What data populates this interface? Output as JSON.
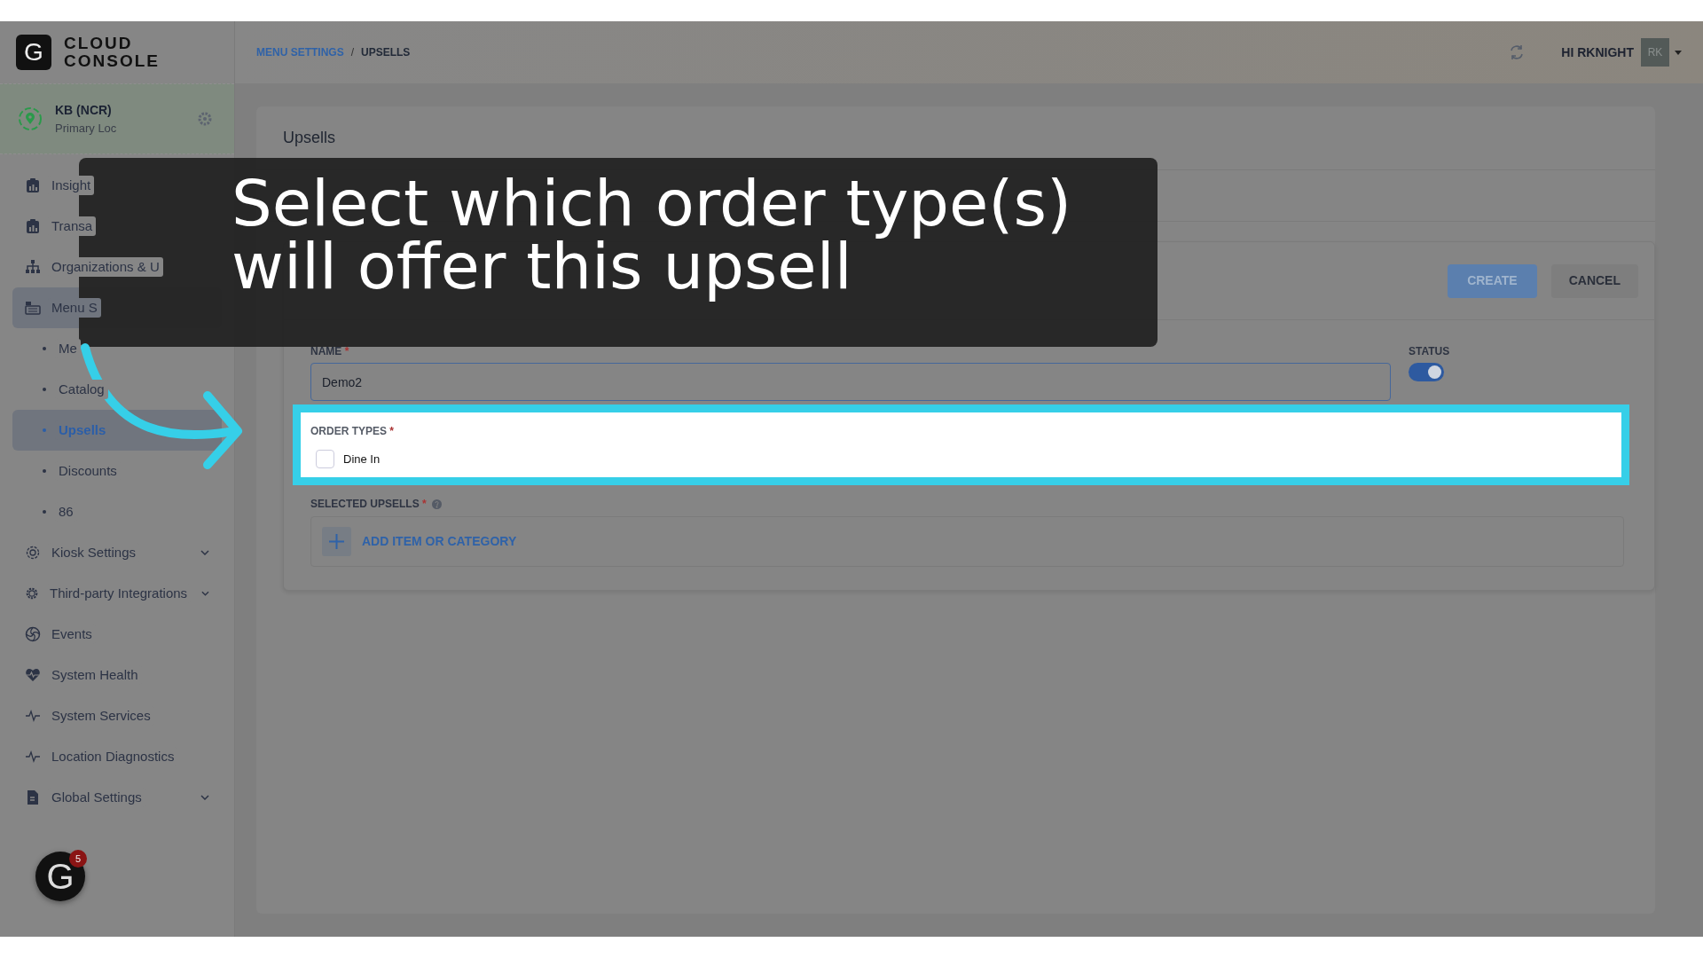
{
  "app": {
    "logo_letter": "G",
    "logo_lines": [
      "CLOUD",
      "CONSOLE"
    ]
  },
  "breadcrumb": [
    {
      "label": "MENU SETTINGS",
      "current": false
    },
    {
      "label": "UPSELLS",
      "current": true
    }
  ],
  "breadcrumb_separator": "/",
  "user": {
    "greeting": "HI RKNIGHT",
    "initials": "RK"
  },
  "location": {
    "name": "KB (NCR)",
    "subtitle": "Primary Loc"
  },
  "sidebar": {
    "items": [
      {
        "label": "Insight",
        "selected": false
      },
      {
        "label": "Transa",
        "selected": false
      },
      {
        "label": "Organizations & U",
        "selected": false
      },
      {
        "label": "Menu S",
        "selected": true,
        "children": [
          {
            "label": "Me",
            "selected": false
          },
          {
            "label": "Catalog",
            "selected": false
          },
          {
            "label": "Upsells",
            "selected": true
          },
          {
            "label": "Discounts",
            "selected": false
          },
          {
            "label": "86",
            "selected": false
          }
        ]
      },
      {
        "label": "Kiosk Settings",
        "expanded": false,
        "selected": false
      },
      {
        "label": "Third-party Integrations",
        "expanded": false,
        "selected": false
      },
      {
        "label": "Events",
        "selected": false
      },
      {
        "label": "System Health",
        "selected": false
      },
      {
        "label": "System Services",
        "selected": false
      },
      {
        "label": "Location Diagnostics",
        "selected": false
      },
      {
        "label": "Global Settings",
        "expanded": false,
        "selected": false
      }
    ]
  },
  "help_badge": {
    "letter": "G",
    "count": "5"
  },
  "page": {
    "title": "Upsells",
    "buttons": [
      {
        "label": "CREATE",
        "kind": "primary"
      },
      {
        "label": "CANCEL",
        "kind": "secondary"
      }
    ],
    "name": {
      "label": "NAME",
      "required_mark": "*",
      "value": "Demo2"
    },
    "status": {
      "label": "STATUS",
      "on": true
    },
    "order_types": {
      "label": "ORDER TYPES",
      "required_mark": "*",
      "options": [
        {
          "label": "Dine In",
          "checked": false
        }
      ]
    },
    "selected_upsells": {
      "label": "SELECTED UPSELLS",
      "required_mark": "*",
      "add_label": "ADD ITEM OR CATEGORY"
    }
  },
  "callout": {
    "text": "Select which order type(s) will offer this upsell"
  }
}
